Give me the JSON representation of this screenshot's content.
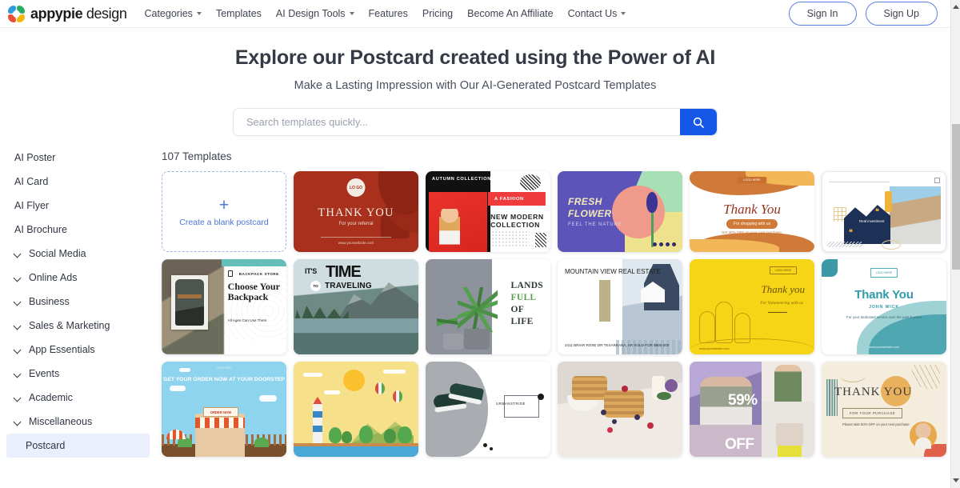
{
  "header": {
    "brand_bold": "appypie",
    "brand_light": "design",
    "nav": [
      {
        "label": "Categories",
        "caret": true
      },
      {
        "label": "Templates",
        "caret": false
      },
      {
        "label": "AI Design Tools",
        "caret": true
      },
      {
        "label": "Features",
        "caret": false
      },
      {
        "label": "Pricing",
        "caret": false
      },
      {
        "label": "Become An Affiliate",
        "caret": false
      },
      {
        "label": "Contact Us",
        "caret": true
      }
    ],
    "sign_in": "Sign In",
    "sign_up": "Sign Up",
    "accent_color": "#1558e8"
  },
  "hero": {
    "title": "Explore our Postcard created using the Power of AI",
    "subtitle": "Make a Lasting Impression with Our AI-Generated Postcard Templates",
    "search_placeholder": "Search templates quickly...",
    "search_value": "",
    "search_icon": "search-icon"
  },
  "sidebar": {
    "items": [
      {
        "label": "AI Poster",
        "expandable": false,
        "active": false,
        "indent": false
      },
      {
        "label": "AI Card",
        "expandable": false,
        "active": false,
        "indent": false
      },
      {
        "label": "AI Flyer",
        "expandable": false,
        "active": false,
        "indent": false
      },
      {
        "label": "AI Brochure",
        "expandable": false,
        "active": false,
        "indent": false
      },
      {
        "label": "Social Media",
        "expandable": true,
        "active": false,
        "indent": false
      },
      {
        "label": "Online Ads",
        "expandable": true,
        "active": false,
        "indent": false
      },
      {
        "label": "Business",
        "expandable": true,
        "active": false,
        "indent": false
      },
      {
        "label": "Sales & Marketing",
        "expandable": true,
        "active": false,
        "indent": false
      },
      {
        "label": "App Essentials",
        "expandable": true,
        "active": false,
        "indent": false
      },
      {
        "label": "Events",
        "expandable": true,
        "active": false,
        "indent": false
      },
      {
        "label": "Academic",
        "expandable": true,
        "active": false,
        "indent": false
      },
      {
        "label": "Miscellaneous",
        "expandable": true,
        "active": false,
        "indent": false
      },
      {
        "label": "Postcard",
        "expandable": false,
        "active": true,
        "indent": true
      }
    ],
    "active_bg": "#eaf0fb"
  },
  "results": {
    "count_label": "107 Templates",
    "blank_card": {
      "plus_icon": "plus-icon",
      "label": "Create a blank postcard"
    },
    "templates": [
      {
        "name": "thank-you-referral-red",
        "logo": "LO GO",
        "title": "THANK YOU",
        "subtitle": "For your referral",
        "url": "www.yourwebsite.com"
      },
      {
        "name": "new-modern-collection",
        "eyebrow": "AUTUMN COLLECTION",
        "tag": "A FASHION",
        "title": "NEW MODERN COLLECTION"
      },
      {
        "name": "fresh-flower",
        "title_line1": "FRESH",
        "title_line2": "FLOWER",
        "subtitle": "FEEL THE NATURE"
      },
      {
        "name": "thank-you-shopping-orange",
        "badge": "LOGO HERE",
        "title": "Thank You",
        "button": "For shopping with us",
        "subtitle": "Get 30% OFF on your next purchase."
      },
      {
        "name": "real-estate-investment",
        "caption": "Real investment"
      },
      {
        "name": "choose-your-backpack",
        "store": "BACKPACK STORE",
        "title": "Choose Your Backpack",
        "subtitle": "All Ages Can Use Them"
      },
      {
        "name": "its-time-to-traveling",
        "word1": "IT'S",
        "word2": "TIME",
        "word3": "TO",
        "word4": "TRAVELING"
      },
      {
        "name": "lands-full-of-life",
        "line1": "LANDS",
        "line2": "FULL",
        "line3": "OF",
        "line4": "LIFE"
      },
      {
        "name": "mountain-view-real-estate",
        "title": "MOUNTAIN VIEW REAL ESTATE",
        "address": "2411 BRIAR ROSE DR TEXARKANA, AR SOLD FOR $600,000"
      },
      {
        "name": "thank-you-volunteering-yellow",
        "logo": "LOGO HERE",
        "title": "Thank you",
        "subtitle": "For Volunteering with us",
        "url": "www.yourwebsite.com"
      },
      {
        "name": "thank-you-john-wick-teal",
        "logo": "LOGO HERE",
        "title": "Thank You",
        "name_line": "JOHN WICK",
        "body": "For your dedicated service over the past 5 years",
        "url": "www.yourwebsite.com"
      },
      {
        "name": "get-your-order-doorstep",
        "logo": "LOGO HERE",
        "title": "GET YOUR ORDER NOW AT YOUR DOORSTEP",
        "button": "ORDER NOW"
      },
      {
        "name": "lighthouse-landscape"
      },
      {
        "name": "urbanstride-sneakers",
        "brand": "URBANSTRIDE"
      },
      {
        "name": "waffles-berries"
      },
      {
        "name": "fashion-sale-59-off",
        "percent": "59%",
        "off": "OFF"
      },
      {
        "name": "thank-you-for-your-purchase",
        "title": "THANK YOU",
        "chip": "FOR YOUR PURCHASE",
        "note": "Please take 50% OFF on your next purchase"
      }
    ]
  },
  "scrollbar": {
    "up_icon": "scroll-up-arrow-icon",
    "down_icon": "scroll-down-arrow-icon",
    "thumb": "scrollbar-thumb"
  }
}
